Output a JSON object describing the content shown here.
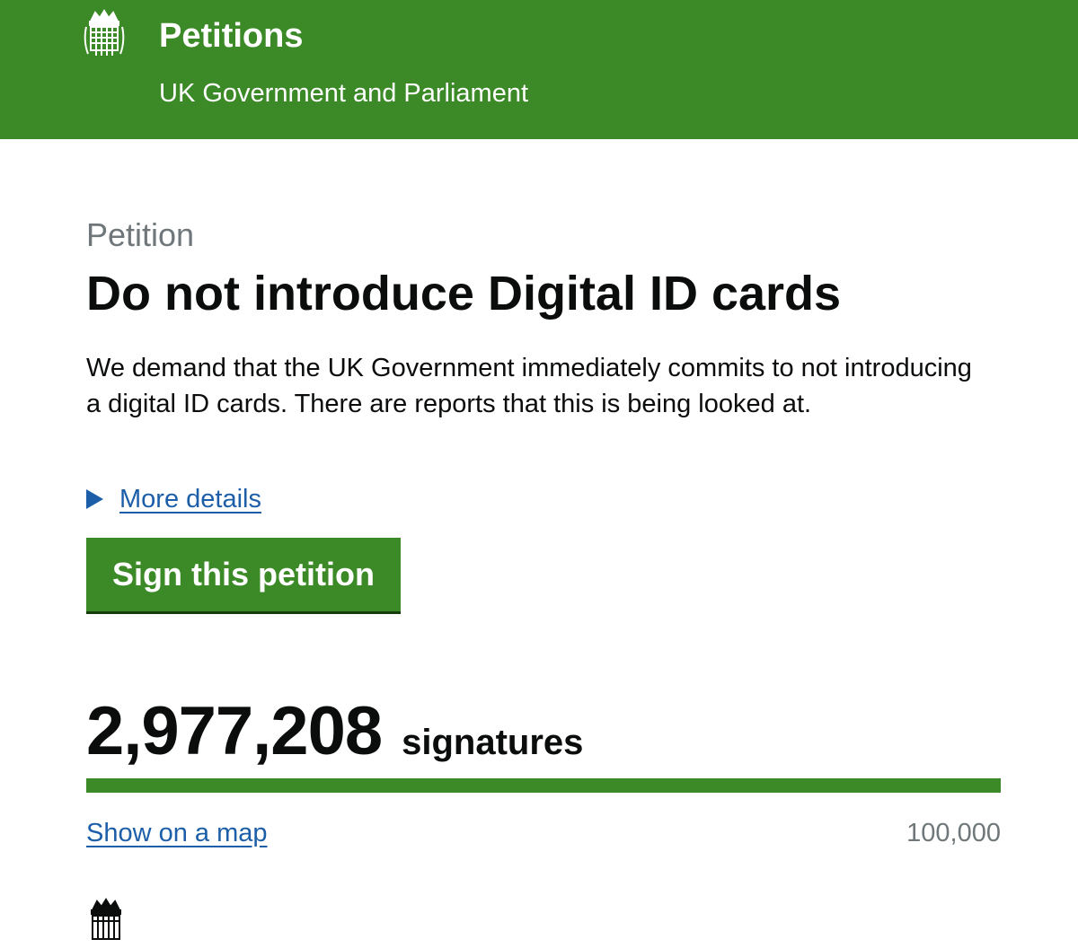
{
  "header": {
    "title": "Petitions",
    "subtitle": "UK Government and Parliament",
    "logo_icon": "portcullis-icon",
    "background_color": "#3c8a27"
  },
  "petition": {
    "caption": "Petition",
    "title": "Do not introduce Digital ID cards",
    "summary": "We demand that the UK Government immediately commits to not introducing a digital ID cards. There are reports that this is being looked at.",
    "more_details_label": "More details",
    "sign_button_label": "Sign this petition"
  },
  "signatures": {
    "count": "2,977,208",
    "label": "signatures",
    "progress_fraction": 1.0,
    "threshold": "100,000",
    "map_link_label": "Show on a map"
  },
  "footer": {
    "logo_icon": "portcullis-icon"
  },
  "colors": {
    "brand_green": "#3c8a27",
    "link_blue": "#1d5ea8",
    "muted_grey": "#6f777b"
  }
}
